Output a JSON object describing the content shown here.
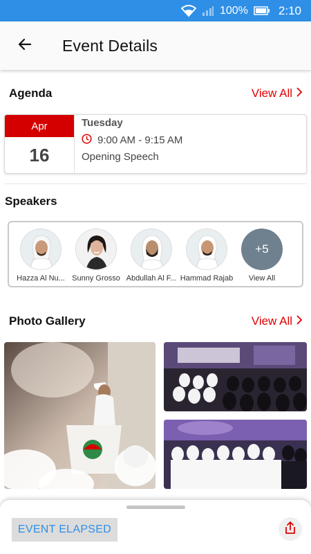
{
  "status_bar": {
    "battery": "100%",
    "time": "2:10"
  },
  "header": {
    "title": "Event Details"
  },
  "agenda": {
    "section_title": "Agenda",
    "view_all": "View All",
    "item": {
      "month": "Apr",
      "day": "16",
      "weekday": "Tuesday",
      "time": "9:00 AM - 9:15 AM",
      "title": "Opening Speech"
    }
  },
  "speakers": {
    "section_title": "Speakers",
    "items": [
      {
        "name": "Hazza Al Nu..."
      },
      {
        "name": "Sunny Grosso"
      },
      {
        "name": "Abdullah Al F..."
      },
      {
        "name": "Hammad Rajab"
      }
    ],
    "more_count": "+5",
    "more_label": "View All"
  },
  "gallery": {
    "section_title": "Photo Gallery",
    "view_all": "View All"
  },
  "bottom": {
    "status_button": "EVENT ELAPSED"
  },
  "colors": {
    "accent_red": "#e00000",
    "status_blue": "#2f8fe6",
    "date_red": "#d40000"
  }
}
